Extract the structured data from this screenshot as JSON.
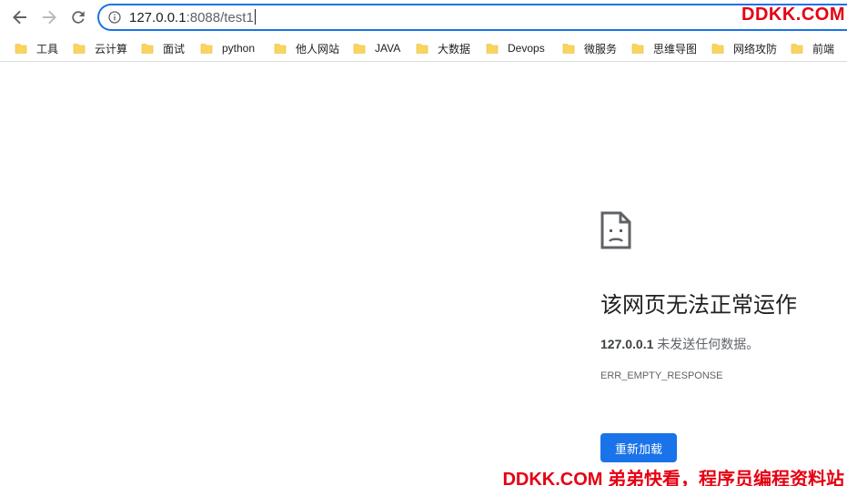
{
  "address_bar": {
    "host": "127.0.0.1",
    "path": ":8088/test1"
  },
  "watermark": {
    "top": "DDKK.COM",
    "bottom": "DDKK.COM 弟弟快看，程序员编程资料站"
  },
  "bookmarks": [
    {
      "label": "工具"
    },
    {
      "label": "云计算"
    },
    {
      "label": "面试"
    },
    {
      "label": "python"
    },
    {
      "label": "他人网站"
    },
    {
      "label": "JAVA"
    },
    {
      "label": "大数据"
    },
    {
      "label": "Devops"
    },
    {
      "label": "微服务"
    },
    {
      "label": "思维导图"
    },
    {
      "label": "网络攻防"
    },
    {
      "label": "前端"
    }
  ],
  "error": {
    "title": "该网页无法正常运作",
    "host": "127.0.0.1",
    "description": " 未发送任何数据。",
    "code": "ERR_EMPTY_RESPONSE",
    "reload_label": "重新加载"
  },
  "colors": {
    "accent": "#1a73e8",
    "watermark": "#e60012",
    "folder": "#fbd45e"
  }
}
